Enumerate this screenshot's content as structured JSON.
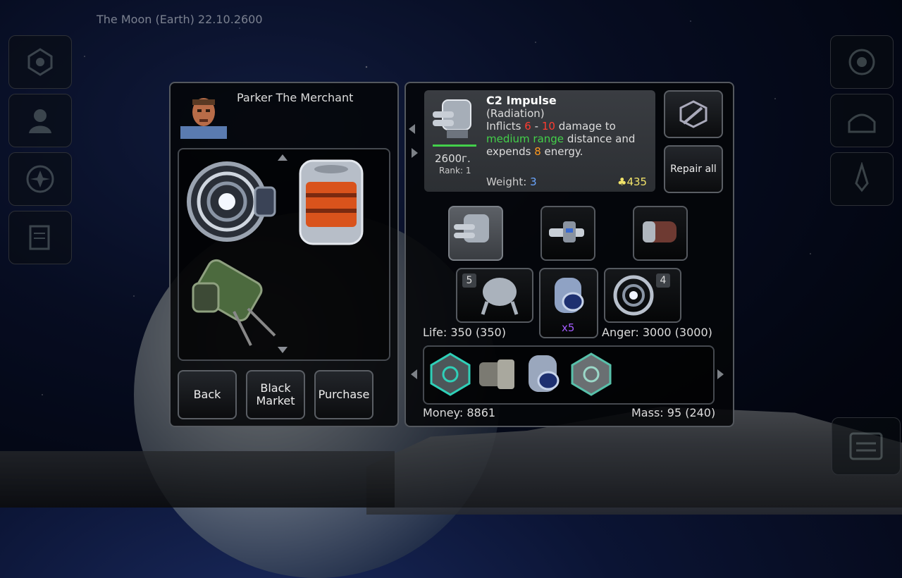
{
  "location": "The Moon (Earth) 22.10.2600",
  "merchant": {
    "name": "Parker The Merchant"
  },
  "buttons": {
    "back": "Back",
    "black_market": "Black\nMarket",
    "purchase": "Purchase",
    "repair_all": "Repair all"
  },
  "item": {
    "name": "C2 Impulse",
    "type": "(Radiation)",
    "desc_inflicts": "Inflicts",
    "dmg_min": "6",
    "dash": "-",
    "dmg_max": "10",
    "desc_damage_to": "damage to",
    "range": "medium range",
    "desc_distance": "distance and",
    "desc_expends": "expends",
    "energy": "8",
    "desc_energy": "energy.",
    "price": "2600г.",
    "rank": "Rank: 1",
    "weight_label": "Weight:",
    "weight": "3",
    "credits": "435",
    "durability_fraction": 1.0
  },
  "ship": {
    "life": "Life: 350 (350)",
    "anger": "Anger: 3000 (3000)",
    "money": "Money: 8861",
    "mass": "Mass: 95 (240)",
    "slot_badges": {
      "left": "5",
      "right": "4",
      "middle_count": "x5"
    }
  },
  "icons": [
    "station-icon",
    "pilot-icon",
    "faction-icon",
    "log-icon",
    "orbit-icon",
    "base-icon",
    "ship-icon",
    "menu-icon",
    "repair-icon"
  ],
  "colors": {
    "damage": "#ff3b30",
    "range": "#43d04a",
    "energy": "#ff9a1e",
    "weight": "#6aa6ff",
    "credits": "#f2e46a",
    "count": "#a45cff"
  }
}
